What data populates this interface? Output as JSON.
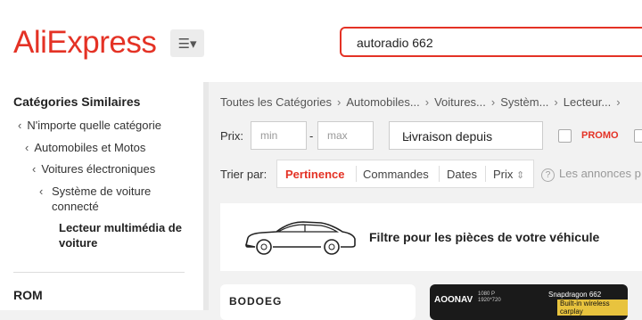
{
  "header": {
    "logo": "AliExpress",
    "search_value": "autoradio 662"
  },
  "sidebar": {
    "title": "Catégories Similaires",
    "items": [
      {
        "label": "N'importe quelle catégorie"
      },
      {
        "label": "Automobiles et Motos"
      },
      {
        "label": "Voitures électroniques"
      },
      {
        "label": "Système de voiture connecté"
      },
      {
        "label": "Lecteur multimédia de voiture"
      }
    ],
    "section2_title": "ROM"
  },
  "breadcrumb": [
    "Toutes les Catégories",
    "Automobiles...",
    "Voitures...",
    "Systèm...",
    "Lecteur..."
  ],
  "filters": {
    "price_label": "Prix:",
    "min_placeholder": "min",
    "max_placeholder": "max",
    "shipping_label": "Livraison depuis",
    "promo_label": "PROMO"
  },
  "sort": {
    "label": "Trier par:",
    "options": [
      "Pertinence",
      "Commandes",
      "Dates",
      "Prix"
    ],
    "info_text": "Les annonces p"
  },
  "vehicle_filter": {
    "label": "Filtre pour les pièces de votre véhicule"
  },
  "products": {
    "p1_brand": "BODOEG",
    "p2_brand": "AOONAV",
    "p2_res": "1080 P 1920*720",
    "p2_chip": "Snapdragon 662",
    "p2_feature": "Built-in wireless carplay"
  },
  "colors": {
    "accent": "#e43225"
  }
}
